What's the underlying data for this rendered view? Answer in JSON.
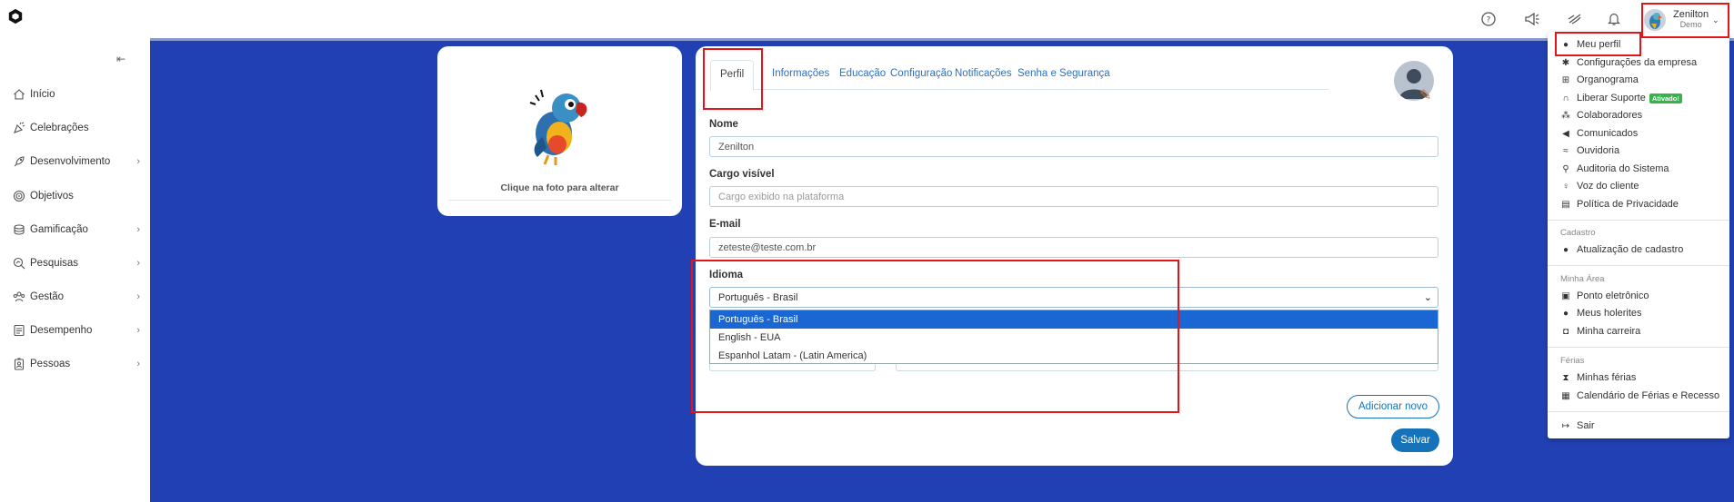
{
  "header": {
    "user": {
      "name": "Zenilton",
      "role": "Demo"
    }
  },
  "sidebar": {
    "items": [
      {
        "label": "Início",
        "icon": "home-icon",
        "has_children": false
      },
      {
        "label": "Celebrações",
        "icon": "party-popper-icon",
        "has_children": false
      },
      {
        "label": "Desenvolvimento",
        "icon": "rocket-icon",
        "has_children": true
      },
      {
        "label": "Objetivos",
        "icon": "target-icon",
        "has_children": false
      },
      {
        "label": "Gamificação",
        "icon": "coins-icon",
        "has_children": true
      },
      {
        "label": "Pesquisas",
        "icon": "search-chart-icon",
        "has_children": true
      },
      {
        "label": "Gestão",
        "icon": "team-icon",
        "has_children": true
      },
      {
        "label": "Desempenho",
        "icon": "report-icon",
        "has_children": true
      },
      {
        "label": "Pessoas",
        "icon": "id-badge-icon",
        "has_children": true
      }
    ]
  },
  "photo_card": {
    "hint": "Clique na foto para alterar"
  },
  "profile_form": {
    "tabs": [
      "Perfil",
      "Informações",
      "Educação",
      "Configuração",
      "Notificações",
      "Senha e Segurança"
    ],
    "active_tab": "Perfil",
    "fields": {
      "nome": {
        "label": "Nome",
        "value": "Zenilton"
      },
      "cargo": {
        "label": "Cargo visível",
        "placeholder": "Cargo exibido na plataforma"
      },
      "email": {
        "label": "E-mail",
        "value": "zeteste@teste.com.br"
      },
      "idioma": {
        "label": "Idioma",
        "selected": "Português - Brasil",
        "options": [
          "Português - Brasil",
          "English - EUA",
          "Espanhol Latam - (Latin America)"
        ]
      }
    },
    "add_button": "Adicionar novo",
    "save_button": "Salvar"
  },
  "user_menu": {
    "items": [
      {
        "label": "Meu perfil",
        "icon": "user-icon"
      },
      {
        "label": "Configurações da empresa",
        "icon": "gear-icon"
      },
      {
        "label": "Organograma",
        "icon": "org-chart-icon"
      },
      {
        "label": "Liberar Suporte",
        "icon": "headset-icon",
        "badge": "Ativado!"
      },
      {
        "label": "Colaboradores",
        "icon": "users-icon"
      },
      {
        "label": "Comunicados",
        "icon": "megaphone-icon"
      },
      {
        "label": "Ouvidoria",
        "icon": "ear-icon"
      },
      {
        "label": "Auditoria do Sistema",
        "icon": "search-icon"
      },
      {
        "label": "Voz do cliente",
        "icon": "lightbulb-icon"
      },
      {
        "label": "Política de Privacidade",
        "icon": "document-icon"
      }
    ],
    "sections": [
      {
        "title": "Cadastro",
        "items": [
          {
            "label": "Atualização de cadastro",
            "icon": "user-icon"
          }
        ]
      },
      {
        "title": "Minha Área",
        "items": [
          {
            "label": "Ponto eletrônico",
            "icon": "id-card-icon"
          },
          {
            "label": "Meus holerites",
            "icon": "money-icon"
          },
          {
            "label": "Minha carreira",
            "icon": "briefcase-icon"
          }
        ]
      },
      {
        "title": "Férias",
        "items": [
          {
            "label": "Minhas férias",
            "icon": "hourglass-icon"
          },
          {
            "label": "Calendário de Férias e Recesso",
            "icon": "calendar-icon"
          }
        ]
      }
    ],
    "logout": {
      "label": "Sair",
      "icon": "logout-icon"
    }
  },
  "colors": {
    "canvas": "#2140b3",
    "primary": "#1673b9",
    "highlight": "#e3141b",
    "option_selected": "#1a66d2"
  }
}
